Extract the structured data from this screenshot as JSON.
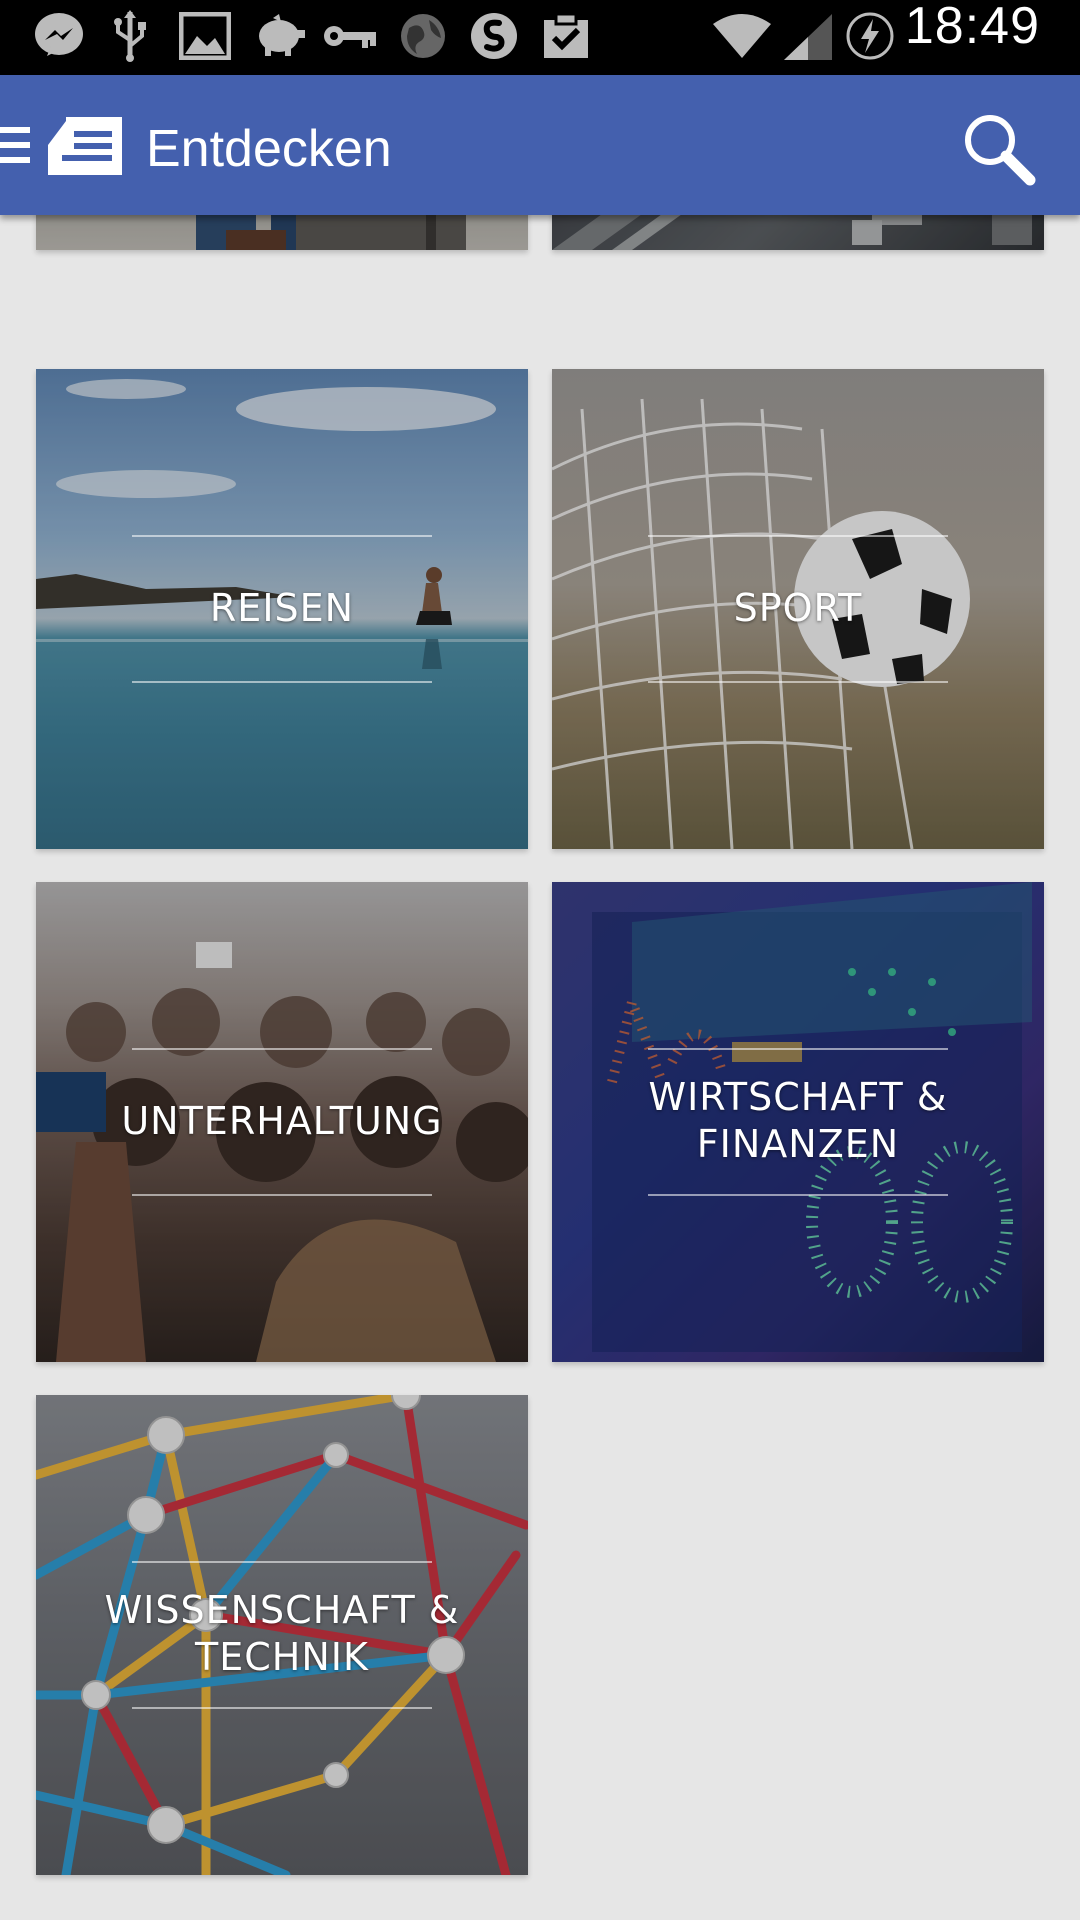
{
  "status_bar": {
    "time": "18:49",
    "icons": [
      "messenger-icon",
      "usb-icon",
      "gallery-icon",
      "piggy-bank-icon",
      "key-icon",
      "globe-icon",
      "shazam-icon",
      "clipboard-check-icon",
      "wifi-icon",
      "signal-icon",
      "battery-charging-icon"
    ]
  },
  "app_bar": {
    "title": "Entdecken",
    "color": "#4460ae"
  },
  "categories": [
    {
      "label": "REISEN"
    },
    {
      "label": "SPORT"
    },
    {
      "label": "UNTERHALTUNG"
    },
    {
      "label": "WIRTSCHAFT &",
      "label2": "FINANZEN"
    },
    {
      "label": "WISSENSCHAFT &",
      "label2": "TECHNIK"
    }
  ]
}
